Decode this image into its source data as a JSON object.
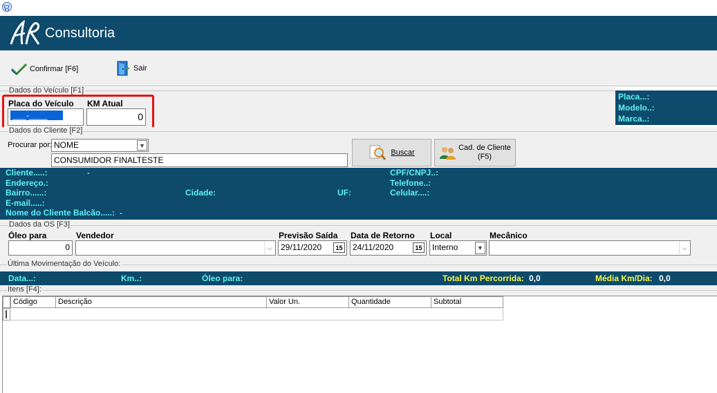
{
  "app": {
    "title": "Consultoria"
  },
  "toolbar": {
    "confirm_label": "Confirmar [F6]",
    "exit_label": "Sair"
  },
  "vehicle": {
    "group_title": "Dados do Veículo [F1]",
    "plate_label": "Placa do Veículo",
    "plate_value": "___-____",
    "km_label": "KM Atual",
    "km_value": "0",
    "info_plate": "Placa...:",
    "info_model": "Modelo..:",
    "info_brand": "Marca..:"
  },
  "client": {
    "group_title": "Dados do Cliente [F2]",
    "search_by_label": "Procurar por:",
    "search_by_value": "NOME",
    "search_text": "CONSUMIDOR FINALTESTE",
    "search_button": "Buscar",
    "register_button": "Cad. de Cliente (F5)",
    "cliente_label": "Cliente.....:",
    "cliente_value": "-",
    "endereco_label": "Endereço.:",
    "bairro_label": "Bairro......:",
    "email_label": "E-mail.....:",
    "balcao_label": "Nome do Cliente Balcão.....:",
    "balcao_value": "-",
    "cidade_label": "Cidade:",
    "uf_label": "UF:",
    "cpf_label": "CPF/CNPJ..:",
    "telefone_label": "Telefone..:",
    "celular_label": "Celular....:"
  },
  "os": {
    "group_title": "Dados da OS [F3]",
    "oleo_label": "Óleo para",
    "oleo_value": "0",
    "vendedor_label": "Vendedor",
    "vendedor_value": "",
    "previsao_label": "Previsão Saída",
    "previsao_value": "29/11/2020",
    "retorno_label": "Data de Retorno",
    "retorno_value": "24/11/2020",
    "local_label": "Local",
    "local_value": "Interno",
    "mecanico_label": "Mecânico",
    "mecanico_value": "",
    "cal_glyph": "15"
  },
  "last_move": {
    "group_title": "Última Movimentação do Veículo:",
    "data_label": "Data...:",
    "km_label": "Km..:",
    "oleo_label": "Óleo para:",
    "total_km_label": "Total Km Percorrida:",
    "total_km_value": "0,0",
    "media_label": "Média Km/Dia:",
    "media_value": "0,0"
  },
  "items": {
    "group_title": "Itens [F4]:",
    "columns": [
      "Código",
      "Descrição",
      "Valor Un.",
      "Quantidade",
      "Subtotal"
    ]
  },
  "colors": {
    "panel": "#0d4a6b",
    "cyan": "#5ff2f2",
    "yellow": "#f8f848",
    "highlight": "#e81010"
  }
}
